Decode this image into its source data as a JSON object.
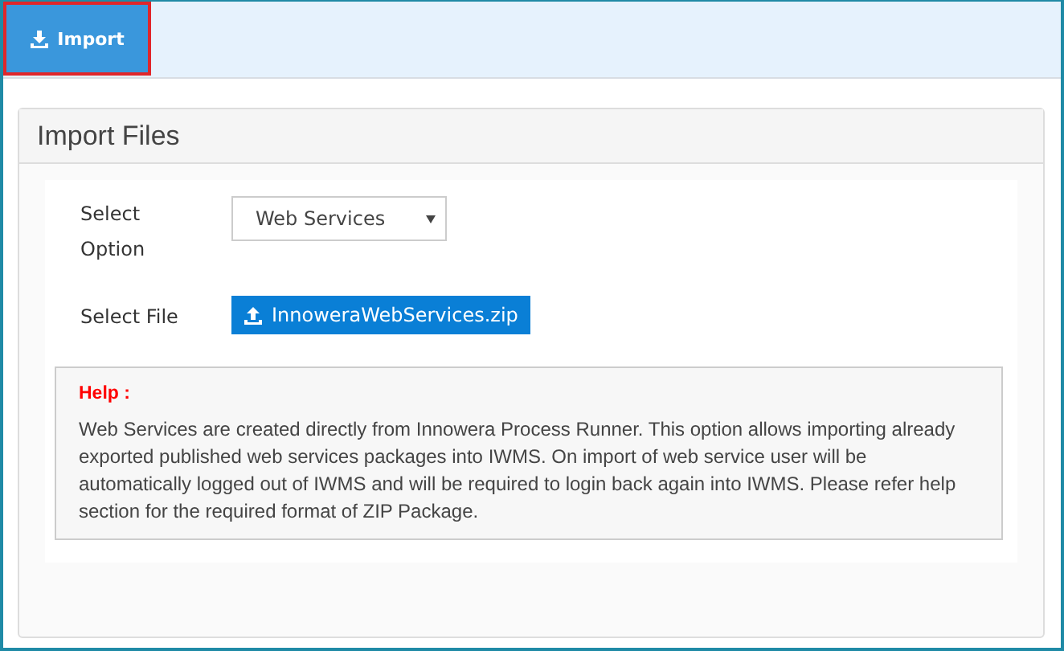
{
  "toolbar": {
    "import_button": {
      "label": "Import",
      "highlighted": true
    }
  },
  "panel": {
    "title": "Import Files",
    "select_option": {
      "label": "Select Option",
      "value": "Web Services"
    },
    "select_file": {
      "label": "Select File",
      "file": "InnoweraWebServices.zip"
    },
    "help": {
      "title": "Help :",
      "text": "Web Services are created directly from Innowera Process Runner. This option allows importing already exported published web services packages into IWMS. On import of web service user will be automatically logged out of IWMS and will be required to login back again into IWMS. Please refer help section for the required format of ZIP Package."
    }
  }
}
